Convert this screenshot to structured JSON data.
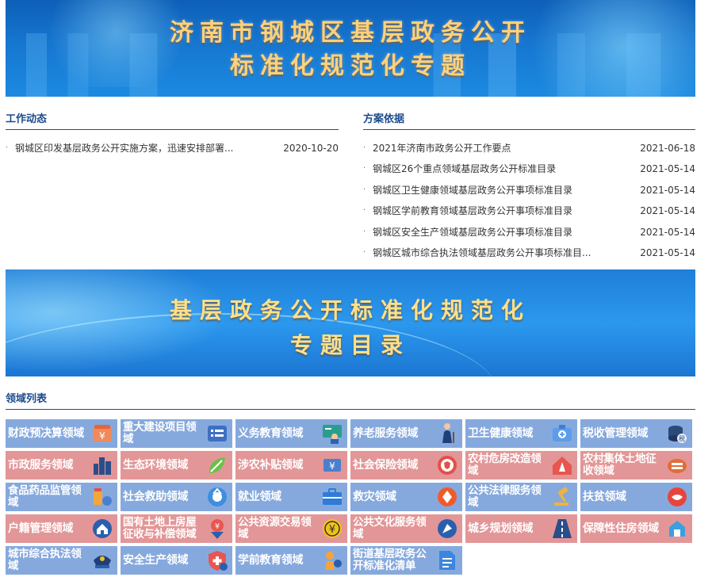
{
  "banner_top": {
    "line1": "济南市钢城区基层政务公开",
    "line2": "标准化规范化专题"
  },
  "work_news": {
    "title": "工作动态",
    "items": [
      {
        "text": "钢城区印发基层政务公开实施方案，迅速安排部署...",
        "date": "2020-10-20"
      }
    ]
  },
  "basis": {
    "title": "方案依据",
    "items": [
      {
        "text": "2021年济南市政务公开工作要点",
        "date": "2021-06-18"
      },
      {
        "text": "钢城区26个重点领域基层政务公开标准目录",
        "date": "2021-05-14"
      },
      {
        "text": "钢城区卫生健康领域基层政务公开事项标准目录",
        "date": "2021-05-14"
      },
      {
        "text": "钢城区学前教育领域基层政务公开事项标准目录",
        "date": "2021-05-14"
      },
      {
        "text": "钢城区安全生产领域基层政务公开事项标准目录",
        "date": "2021-05-14"
      },
      {
        "text": "钢城区城市综合执法领域基层政务公开事项标准目...",
        "date": "2021-05-14"
      }
    ]
  },
  "banner_mid": {
    "line1": "基层政务公开标准化规范化",
    "line2": "专题目录"
  },
  "domains": {
    "title": "领域列表",
    "colors": {
      "blue": "#86a9dd",
      "pink": "#e39697"
    },
    "rows": [
      [
        {
          "label": "财政预决算领域",
          "color": "blue",
          "icon": "money-bag-icon"
        },
        {
          "label": "重大建设项目领域",
          "color": "blue",
          "icon": "list-icon"
        },
        {
          "label": "义务教育领域",
          "color": "blue",
          "icon": "teacher-icon"
        },
        {
          "label": "养老服务领域",
          "color": "blue",
          "icon": "elderly-icon"
        },
        {
          "label": "卫生健康领域",
          "color": "blue",
          "icon": "medical-kit-icon"
        },
        {
          "label": "税收管理领域",
          "color": "blue",
          "icon": "coins-icon"
        }
      ],
      [
        {
          "label": "市政服务领域",
          "color": "pink",
          "icon": "city-icon"
        },
        {
          "label": "生态环境领域",
          "color": "pink",
          "icon": "leaf-icon"
        },
        {
          "label": "涉农补贴领域",
          "color": "pink",
          "icon": "subsidy-icon"
        },
        {
          "label": "社会保险领域",
          "color": "pink",
          "icon": "insurance-icon"
        },
        {
          "label": "农村危房改造领域",
          "color": "pink",
          "icon": "house-icon"
        },
        {
          "label": "农村集体土地征收领域",
          "color": "pink",
          "icon": "land-icon"
        }
      ],
      [
        {
          "label": "食品药品监管领域",
          "color": "blue",
          "icon": "medicine-icon"
        },
        {
          "label": "社会救助领域",
          "color": "blue",
          "icon": "rescue-icon"
        },
        {
          "label": "就业领域",
          "color": "blue",
          "icon": "briefcase-icon"
        },
        {
          "label": "救灾领域",
          "color": "blue",
          "icon": "disaster-icon"
        },
        {
          "label": "公共法律服务领域",
          "color": "blue",
          "icon": "gavel-icon"
        },
        {
          "label": "扶贫领域",
          "color": "blue",
          "icon": "handshake-icon"
        }
      ],
      [
        {
          "label": "户籍管理领域",
          "color": "pink",
          "icon": "home-icon"
        },
        {
          "label": "国有土地上房屋征收与补偿领域",
          "color": "pink",
          "icon": "yuan-down-icon"
        },
        {
          "label": "公共资源交易领域",
          "color": "pink",
          "icon": "yuan-icon"
        },
        {
          "label": "公共文化服务领域",
          "color": "pink",
          "icon": "culture-icon"
        },
        {
          "label": "城乡规划领域",
          "color": "pink",
          "icon": "road-icon"
        },
        {
          "label": "保障性住房领域",
          "color": "pink",
          "icon": "building-icon"
        }
      ],
      [
        {
          "label": "城市综合执法领域",
          "color": "blue",
          "icon": "police-cap-icon"
        },
        {
          "label": "安全生产领域",
          "color": "blue",
          "icon": "shield-icon"
        },
        {
          "label": "学前教育领域",
          "color": "blue",
          "icon": "child-icon"
        },
        {
          "label": "街道基层政务公开标准化清单",
          "color": "blue",
          "icon": "document-icon"
        }
      ]
    ]
  }
}
